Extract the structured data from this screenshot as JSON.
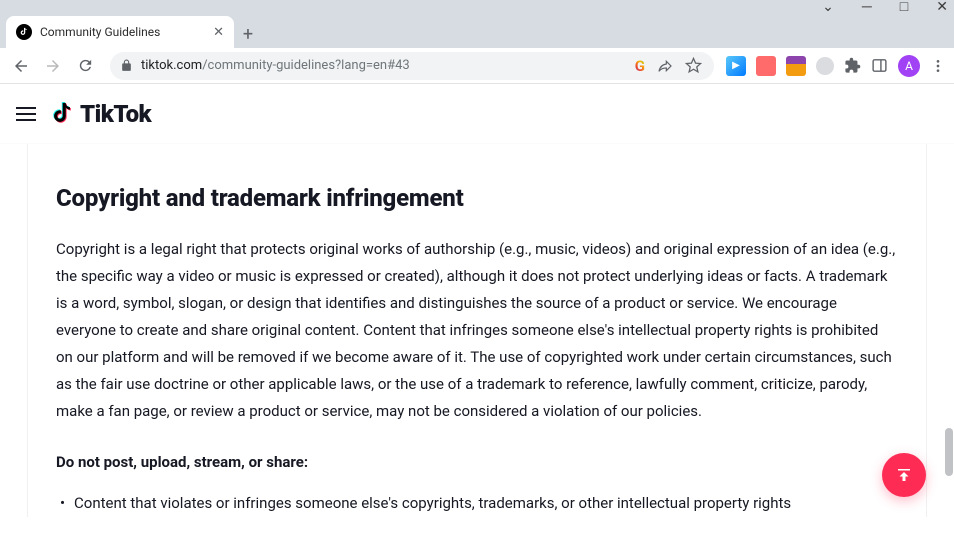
{
  "window": {
    "minimize": "─",
    "maximize": "□",
    "close": "✕",
    "caret": "⌄"
  },
  "tab": {
    "title": "Community Guidelines"
  },
  "toolbar": {
    "url_domain": "tiktok.com",
    "url_path": "/community-guidelines?lang=en#43",
    "avatar_letter": "A"
  },
  "site": {
    "brand": "TikTok"
  },
  "article": {
    "heading": "Copyright and trademark infringement",
    "paragraph": "Copyright is a legal right that protects original works of authorship (e.g., music, videos) and original expression of an idea (e.g., the specific way a video or music is expressed or created), although it does not protect underlying ideas or facts. A trademark is a word, symbol, slogan, or design that identifies and distinguishes the source of a product or service. We encourage everyone to create and share original content. Content that infringes someone else's intellectual property rights is prohibited on our platform and will be removed if we become aware of it. The use of copyrighted work under certain circumstances, such as the fair use doctrine or other applicable laws, or the use of a trademark to reference, lawfully comment, criticize, parody, make a fan page, or review a product or service, may not be considered a violation of our policies.",
    "donot_label": "Do not post, upload, stream, or share:",
    "bullets": [
      "Content that violates or infringes someone else's copyrights, trademarks, or other intellectual property rights"
    ]
  }
}
